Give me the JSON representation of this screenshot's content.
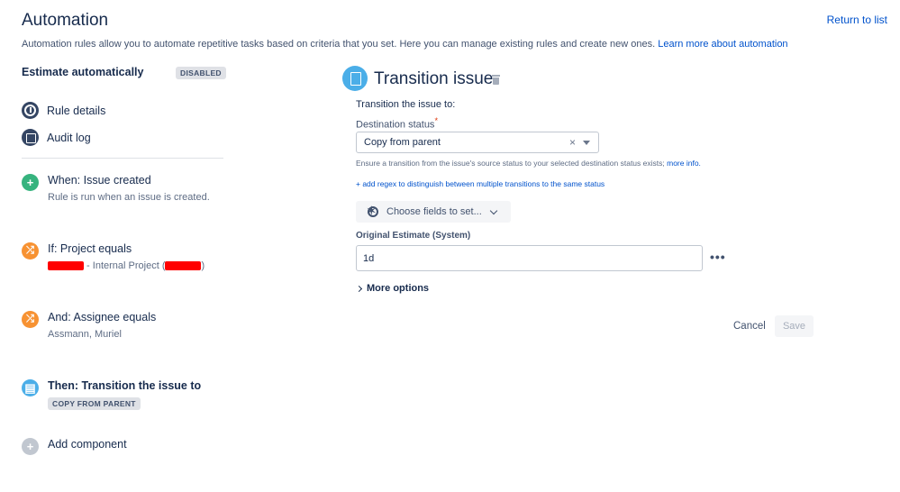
{
  "header": {
    "title": "Automation",
    "return_link": "Return to list",
    "intro_text": "Automation rules allow you to automate repetitive tasks based on criteria that you set. Here you can manage existing rules and create new ones.",
    "learn_more_link": "Learn more about automation"
  },
  "sidebar": {
    "rule_name": "Estimate automatically",
    "rule_status": "DISABLED",
    "nav": [
      {
        "label": "Rule details",
        "icon": "info-icon"
      },
      {
        "label": "Audit log",
        "icon": "log-icon"
      }
    ],
    "components": [
      {
        "title": "When: Issue created",
        "subtitle": "Rule is run when an issue is created.",
        "icon": "plus-icon",
        "color": "#36b37e"
      },
      {
        "title": "If: Project equals",
        "subtitle": " - Internal Project (",
        "subtitle_end": ")",
        "icon": "shuffle-icon",
        "color": "#f79232"
      },
      {
        "title": "And: Assignee equals",
        "subtitle": "Assmann, Muriel",
        "icon": "shuffle-icon",
        "color": "#f79232"
      },
      {
        "title": "Then: Transition the issue to",
        "badge": "COPY FROM PARENT",
        "icon": "document-icon",
        "color": "#4baee8"
      },
      {
        "title": "Add component",
        "icon": "plus-icon",
        "color": "#c1c7d0"
      }
    ]
  },
  "panel": {
    "title": "Transition issue",
    "subtitle": "Transition the issue to:",
    "destination_label": "Destination status",
    "required_marker": "*",
    "destination_value": "Copy from parent",
    "clear_glyph": "×",
    "hint_text": "Ensure a transition from the issue's source status to your selected destination status exists;",
    "hint_link": "more info.",
    "regex_link": "+ add regex to distinguish between multiple transitions to the same status",
    "choose_fields_label": "Choose fields to set...",
    "field_label": "Original Estimate (System)",
    "field_value": "1d",
    "more_glyph": "•••",
    "more_options": "More options",
    "cancel_label": "Cancel",
    "save_label": "Save"
  },
  "colors": {
    "link": "#0052cc",
    "text": "#172b4d",
    "green": "#36b37e",
    "orange": "#f79232",
    "blue": "#4baee8",
    "required": "#de350b"
  }
}
